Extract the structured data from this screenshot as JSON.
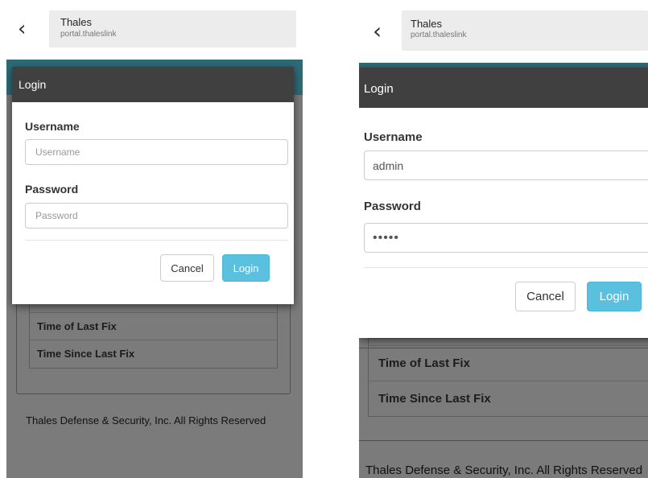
{
  "screens": [
    {
      "browser": {
        "title": "Thales",
        "url": "portal.thaleslink",
        "back_icon": "chevron-left-icon",
        "back_glyph": "‹"
      },
      "modal": {
        "title": "Login",
        "username_label": "Username",
        "username_value": "",
        "username_placeholder": "Username",
        "password_label": "Password",
        "password_value": "",
        "password_placeholder": "Password",
        "cancel_label": "Cancel",
        "login_label": "Login"
      },
      "info_rows": [
        "Time of Last Fix",
        "Time Since Last Fix"
      ],
      "footer": "Thales Defense & Security, Inc. All Rights Reserved"
    },
    {
      "browser": {
        "title": "Thales",
        "url": "portal.thaleslink",
        "back_icon": "chevron-left-icon",
        "back_glyph": "‹"
      },
      "modal": {
        "title": "Login",
        "username_label": "Username",
        "username_value": "admin",
        "username_placeholder": "Username",
        "password_label": "Password",
        "password_value": "admin",
        "password_placeholder": "Password",
        "cancel_label": "Cancel",
        "login_label": "Login"
      },
      "info_rows": [
        "Time of Last Fix",
        "Time Since Last Fix"
      ],
      "footer": "Thales Defense & Security, Inc. All Rights Reserved"
    }
  ],
  "colors": {
    "modal_header": "#404040",
    "login_button": "#5bc0de",
    "teal_bar": "#2e6b79",
    "overlay": "#7b7b7b"
  }
}
